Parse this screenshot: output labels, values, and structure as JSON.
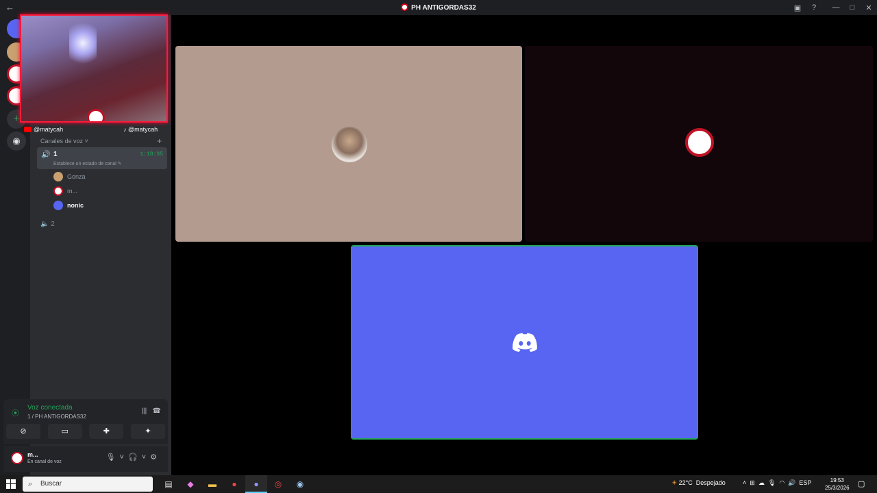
{
  "window": {
    "title": "PH ANTIGORDAS32"
  },
  "titlebar_icons": [
    "back-arrow-icon",
    "inbox-icon",
    "help-icon",
    "minimize-icon",
    "maximize-icon",
    "close-icon"
  ],
  "overlay": {
    "handle_left": "@matycah",
    "handle_right": "@matycah"
  },
  "channels": {
    "category": "Canales de voz",
    "voice1": {
      "name": "1",
      "timer": "1:18:35",
      "status": "Establece un estado de canal"
    },
    "members": [
      {
        "name": "Gonza"
      },
      {
        "name": "m..."
      },
      {
        "name": "nonic"
      }
    ],
    "voice2": {
      "name": "2"
    }
  },
  "voice_panel": {
    "title": "Voz conectada",
    "subtitle": "1 / PH ANTIGORDAS32"
  },
  "user_panel": {
    "name": "m...",
    "status": "En canal de voz"
  },
  "taskbar": {
    "search_placeholder": "Buscar",
    "weather_temp": "22°C",
    "weather_desc": "Despejado",
    "lang": "ESP",
    "time": "19:53",
    "date": "25/3/2026"
  },
  "colors": {
    "blurple": "#5865f2",
    "green": "#23a559",
    "brand_red": "#c01226"
  }
}
